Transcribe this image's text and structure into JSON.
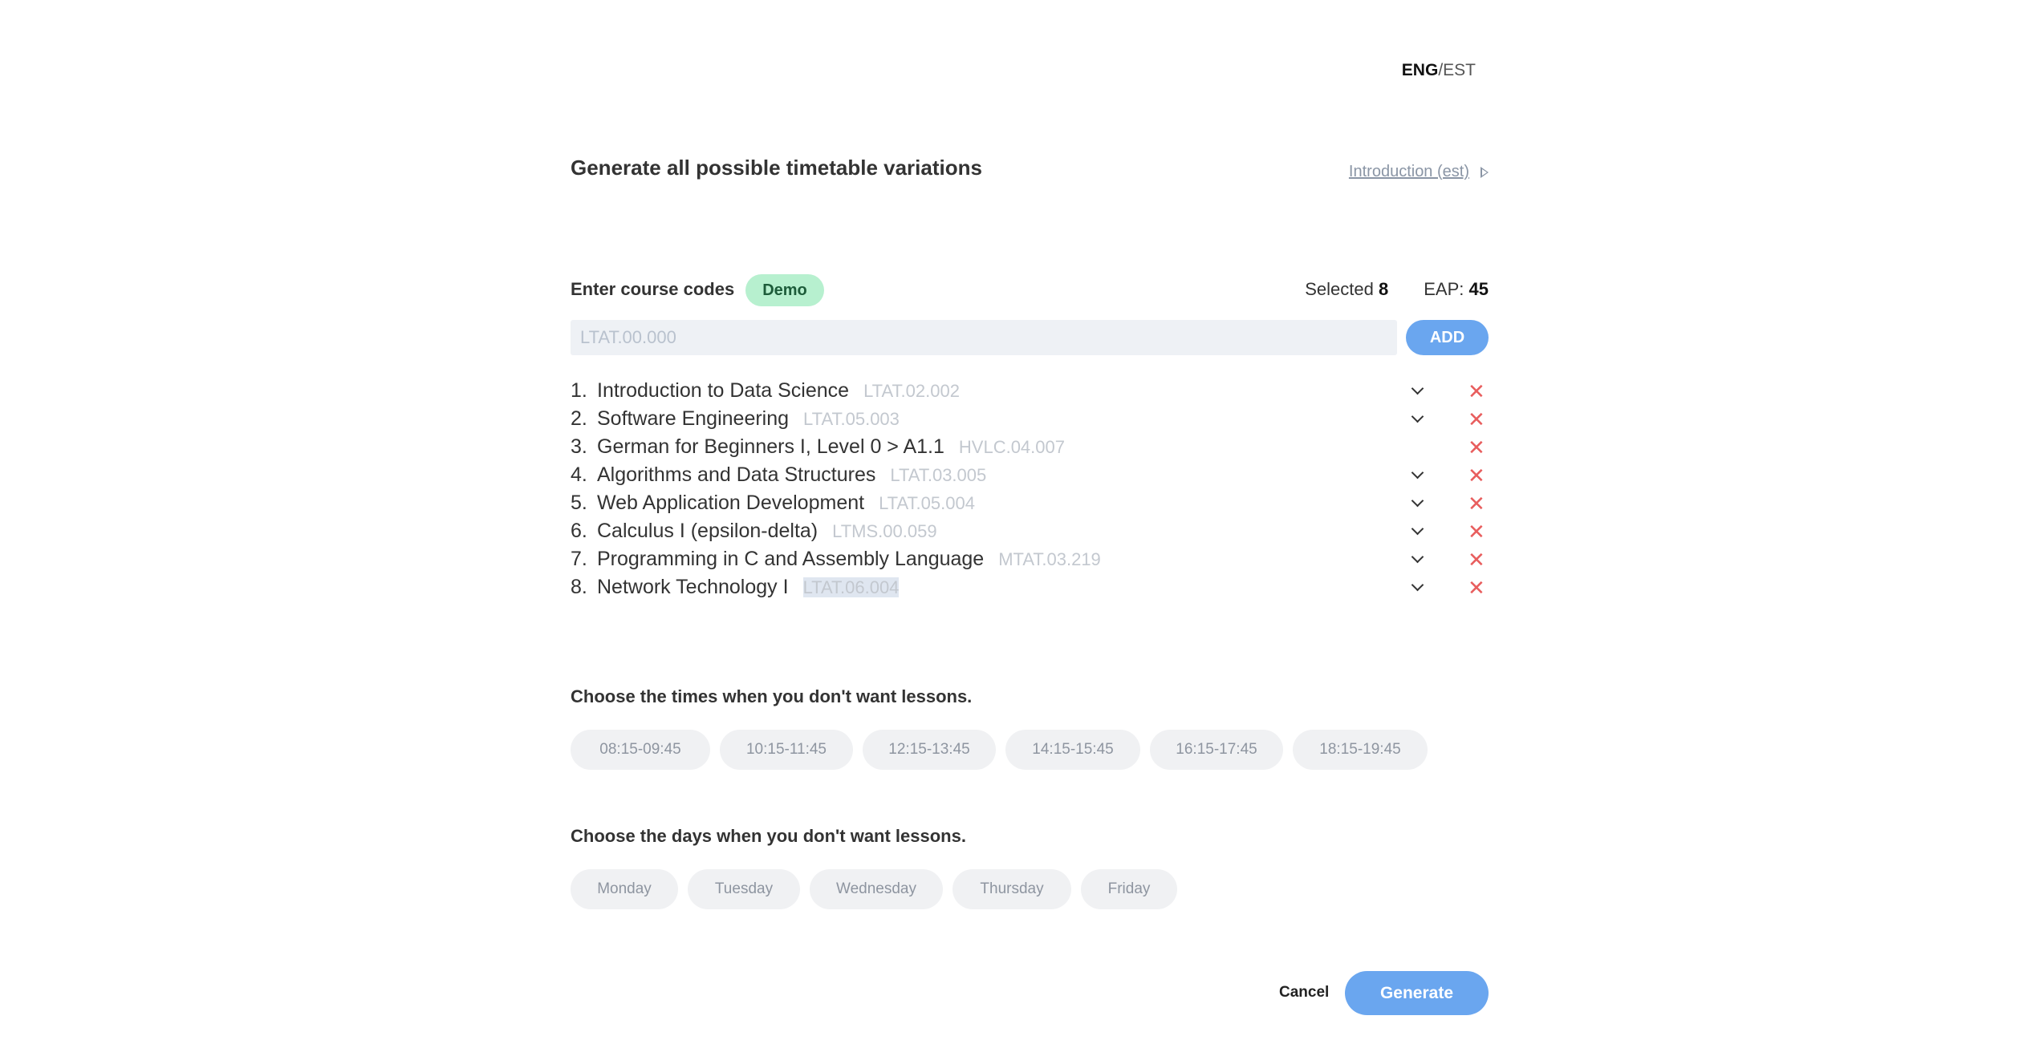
{
  "language": {
    "active": "ENG",
    "separator": "/",
    "other": "EST"
  },
  "header": {
    "title": "Generate all possible timetable variations",
    "intro_link": "Introduction (est)"
  },
  "courses_section": {
    "label": "Enter course codes",
    "demo_label": "Demo",
    "selected_label": "Selected",
    "selected_count": "8",
    "eap_label": "EAP:",
    "eap_value": "45",
    "input_placeholder": "LTAT.00.000",
    "add_label": "ADD"
  },
  "courses": [
    {
      "num": "1.",
      "name": "Introduction to Data Science",
      "code": "LTAT.02.002",
      "has_dropdown": true
    },
    {
      "num": "2.",
      "name": "Software Engineering",
      "code": "LTAT.05.003",
      "has_dropdown": true
    },
    {
      "num": "3.",
      "name": "German for Beginners I, Level 0 > A1.1",
      "code": "HVLC.04.007",
      "has_dropdown": false
    },
    {
      "num": "4.",
      "name": "Algorithms and Data Structures",
      "code": "LTAT.03.005",
      "has_dropdown": true
    },
    {
      "num": "5.",
      "name": "Web Application Development",
      "code": "LTAT.05.004",
      "has_dropdown": true
    },
    {
      "num": "6.",
      "name": "Calculus I (epsilon-delta)",
      "code": "LTMS.00.059",
      "has_dropdown": true
    },
    {
      "num": "7.",
      "name": "Programming in C and Assembly Language",
      "code": "MTAT.03.219",
      "has_dropdown": true
    },
    {
      "num": "8.",
      "name": "Network Technology I",
      "code": "LTAT.06.004",
      "has_dropdown": true,
      "highlighted": true
    }
  ],
  "delete_glyph": "✕",
  "times_section": {
    "label": "Choose the times when you don't want lessons.",
    "options": [
      "08:15-09:45",
      "10:15-11:45",
      "12:15-13:45",
      "14:15-15:45",
      "16:15-17:45",
      "18:15-19:45"
    ]
  },
  "days_section": {
    "label": "Choose the days when you don't want lessons.",
    "options": [
      "Monday",
      "Tuesday",
      "Wednesday",
      "Thursday",
      "Friday"
    ]
  },
  "footer": {
    "cancel_label": "Cancel",
    "generate_label": "Generate"
  },
  "colors": {
    "accent": "#6aa6ef",
    "demo_bg": "#b7f0cf",
    "delete": "#e85d5d",
    "chip_bg": "#f0f1f3"
  }
}
